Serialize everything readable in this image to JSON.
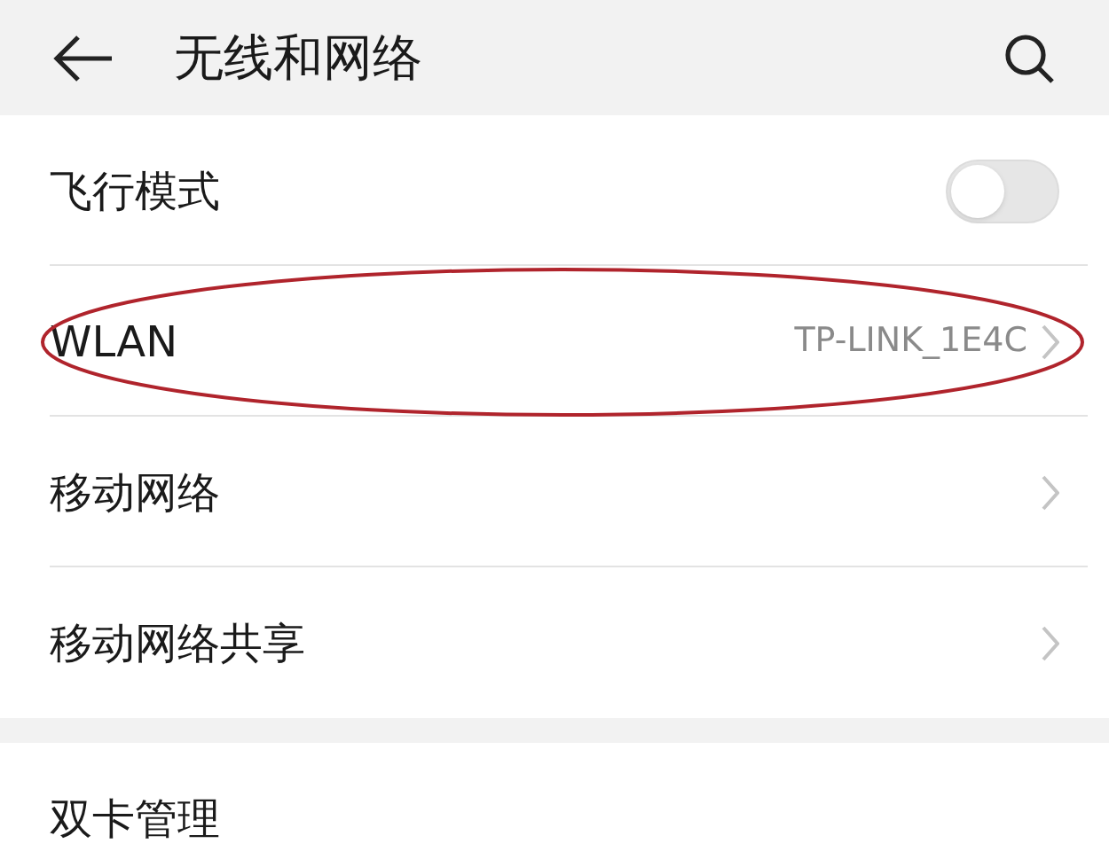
{
  "header": {
    "title": "无线和网络"
  },
  "sections": [
    {
      "items": [
        {
          "kind": "toggle",
          "label": "飞行模式",
          "on": false,
          "circled": false
        },
        {
          "kind": "link",
          "label": "WLAN",
          "value": "TP-LINK_1E4C",
          "circled": true
        },
        {
          "kind": "link",
          "label": "移动网络",
          "circled": false
        },
        {
          "kind": "link",
          "label": "移动网络共享",
          "circled": false
        }
      ]
    },
    {
      "items": [
        {
          "kind": "plain",
          "label": "双卡管理",
          "circled": false
        }
      ]
    }
  ]
}
